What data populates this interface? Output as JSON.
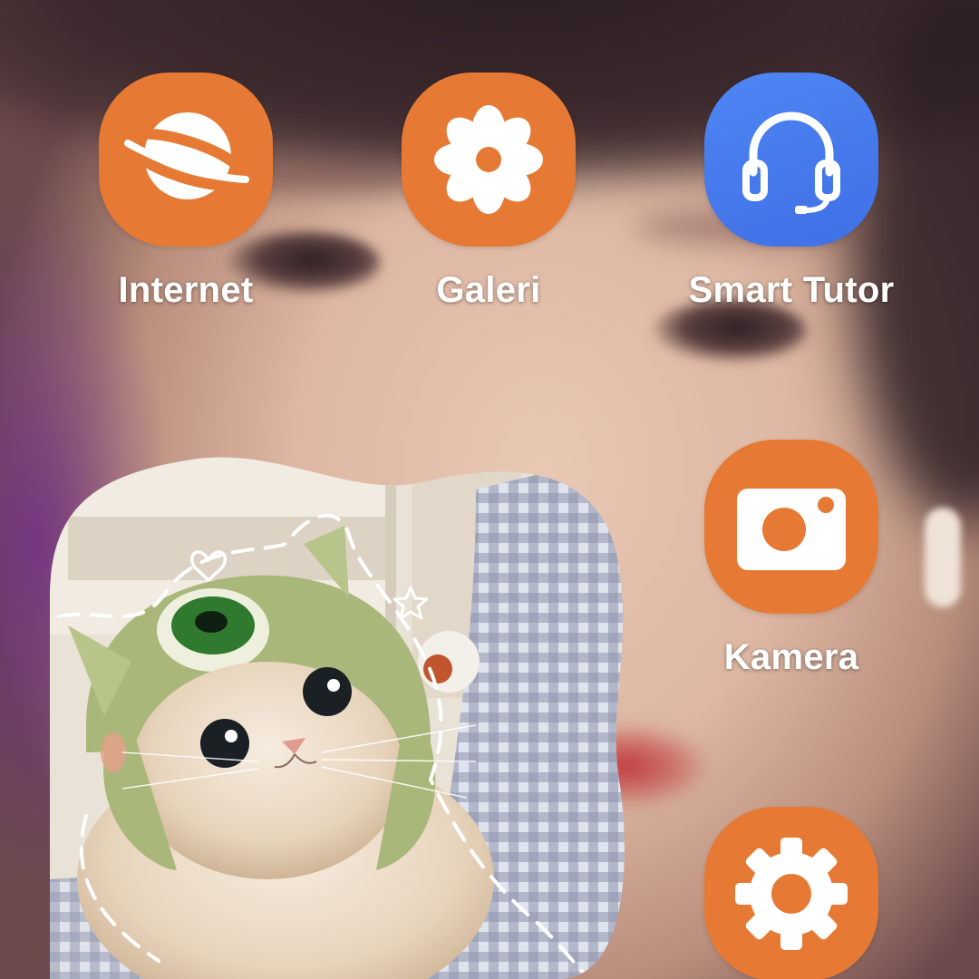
{
  "screen": {
    "type": "home-screen"
  },
  "apps": {
    "internet": {
      "label": "Internet",
      "icon": "planet-icon",
      "color": "#e67a35"
    },
    "galeri": {
      "label": "Galeri",
      "icon": "flower-icon",
      "color": "#e67a35"
    },
    "tutor": {
      "label": "Smart Tutor",
      "icon": "headset-icon",
      "color": "#4a7ef0"
    },
    "kamera": {
      "label": "Kamera",
      "icon": "camera-icon",
      "color": "#e67a35"
    },
    "settings": {
      "label": "",
      "icon": "gear-icon",
      "color": "#e67a35"
    }
  },
  "widget": {
    "type": "photo",
    "subject": "cat-in-green-hat",
    "icons": [
      "heart-doodle-icon",
      "star-doodle-icon"
    ]
  },
  "wallpaper": {
    "accent_colors": [
      "#e8c8b4",
      "#2a1d22",
      "#c0393d",
      "#6e2a8c"
    ]
  }
}
